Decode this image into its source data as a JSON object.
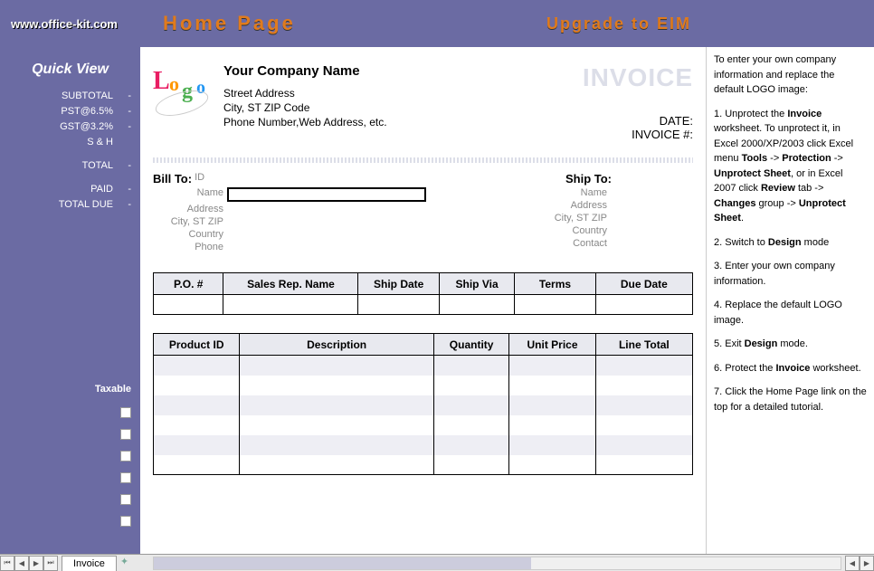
{
  "topbar": {
    "url": "www.office-kit.com",
    "home": "Home Page",
    "upgrade": "Upgrade to EIM"
  },
  "quickview": {
    "title": "Quick  View",
    "rows": [
      {
        "label": "SUBTOTAL",
        "value": "-"
      },
      {
        "label": "PST@6.5%",
        "value": "-"
      },
      {
        "label": "GST@3.2%",
        "value": "-"
      },
      {
        "label": "S & H",
        "value": ""
      },
      {
        "label": "TOTAL",
        "value": "-"
      },
      {
        "label": "PAID",
        "value": "-"
      },
      {
        "label": "TOTAL DUE",
        "value": "-"
      }
    ],
    "taxable": "Taxable"
  },
  "company": {
    "name": "Your Company Name",
    "line1": "Street Address",
    "line2": "City, ST  ZIP Code",
    "line3": "Phone Number,Web Address, etc."
  },
  "invoice": {
    "title": "INVOICE",
    "date_label": "DATE:",
    "num_label": "INVOICE #:"
  },
  "billto": {
    "title": "Bill To:",
    "id": "ID",
    "name": "Name",
    "address": "Address",
    "cityzip": "City, ST ZIP",
    "country": "Country",
    "phone": "Phone"
  },
  "shipto": {
    "title": "Ship To:",
    "name": "Name",
    "address": "Address",
    "cityzip": "City, ST ZIP",
    "country": "Country",
    "contact": "Contact"
  },
  "info_headers": [
    "P.O. #",
    "Sales Rep. Name",
    "Ship Date",
    "Ship Via",
    "Terms",
    "Due Date"
  ],
  "item_headers": [
    "Product ID",
    "Description",
    "Quantity",
    "Unit Price",
    "Line Total"
  ],
  "help": {
    "intro": "To enter your own company information and replace the default LOGO image:",
    "s1a": "1. Unprotect the ",
    "s1b": "Invoice",
    "s1c": " worksheet. To unprotect it, in Excel 2000/XP/2003 click Excel menu ",
    "s1d": "Tools",
    "s1e": " -> ",
    "s1f": "Protection",
    "s1g": " -> ",
    "s1h": "Unprotect Sheet",
    "s1i": ", or in Excel 2007 click ",
    "s1j": "Review",
    "s1k": " tab -> ",
    "s1l": "Changes",
    "s1m": " group -> ",
    "s1n": "Unprotect Sheet",
    "s1o": ".",
    "s2a": "2. Switch to ",
    "s2b": "Design",
    "s2c": " mode",
    "s3": "3. Enter your own company information.",
    "s4": "4. Replace the default LOGO image.",
    "s5a": "5. Exit ",
    "s5b": "Design",
    "s5c": " mode.",
    "s6a": "6. Protect the ",
    "s6b": "Invoice",
    "s6c": " worksheet.",
    "s7": "7. Click the Home Page link on the top for a detailed tutorial."
  },
  "tabs": {
    "sheet": "Invoice"
  }
}
